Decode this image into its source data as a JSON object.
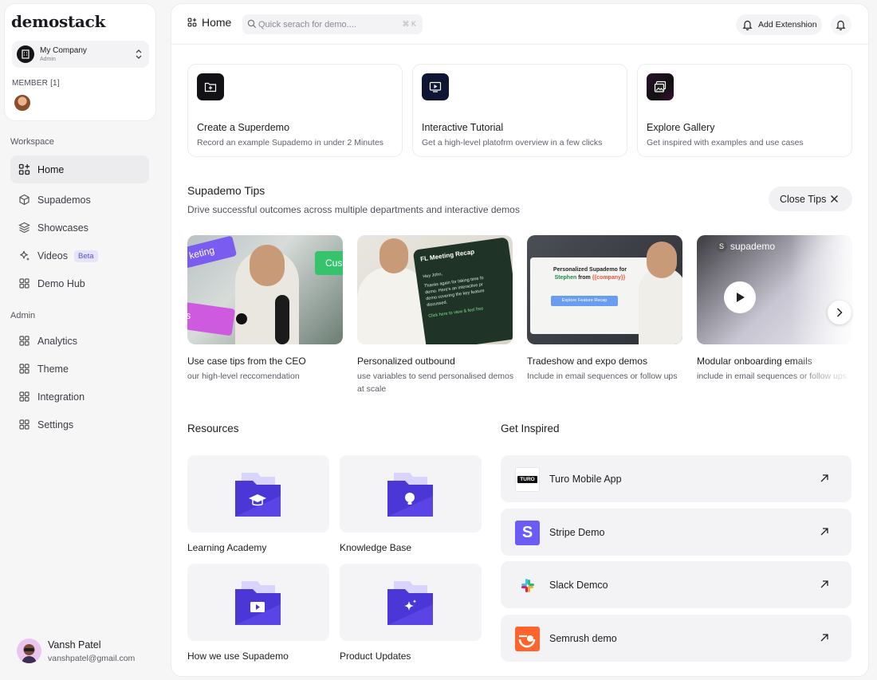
{
  "brand": "demostack",
  "workspace": {
    "company_name": "My Company",
    "company_role": "Admin",
    "member_label": "MEMBER [1]"
  },
  "sidebar": {
    "workspace_label": "Workspace",
    "workspace_items": [
      {
        "label": "Home",
        "icon": "home-grid-icon",
        "active": true
      },
      {
        "label": "Supademos",
        "icon": "cube-icon"
      },
      {
        "label": "Showcases",
        "icon": "layers-icon"
      },
      {
        "label": "Videos",
        "icon": "sparkle-icon",
        "badge": "Beta"
      },
      {
        "label": "Demo Hub",
        "icon": "grid-icon"
      }
    ],
    "admin_label": "Admin",
    "admin_items": [
      {
        "label": "Analytics",
        "icon": "grid-icon"
      },
      {
        "label": "Theme",
        "icon": "grid-icon"
      },
      {
        "label": "Integration",
        "icon": "grid-icon"
      },
      {
        "label": "Settings",
        "icon": "grid-icon"
      }
    ]
  },
  "user": {
    "name": "Vansh Patel",
    "email": "vanshpatel@gmail.com"
  },
  "topbar": {
    "title": "Home",
    "search_placeholder": "Quick serach for demo....",
    "search_shortcut": "⌘ K",
    "add_extension": "Add Extenshion"
  },
  "quick_actions": [
    {
      "title": "Create a Superdemo",
      "subtitle": "Record an example Supademo in under 2 Minutes",
      "icon": "folder-plus-icon"
    },
    {
      "title": "Interactive Tutorial",
      "subtitle": "Get a high-level platofrm overview in a few clicks",
      "icon": "play-screen-icon"
    },
    {
      "title": "Explore Gallery",
      "subtitle": "Get inspired with examples and use cases",
      "icon": "gallery-icon"
    }
  ],
  "tips": {
    "title": "Supademo Tips",
    "subtitle": "Drive successful outcomes across multiple departments and interactive demos",
    "close_label": "Close Tips",
    "items": [
      {
        "title": "Use case tips from the CEO",
        "desc": "our high-level reccomendation",
        "thumb_tags": [
          "keting",
          "Cus",
          "s"
        ]
      },
      {
        "title": "Personalized outbound",
        "desc": "use variables to send personalised demos at scale",
        "thumb_card_title": "FL Meeting Recap",
        "thumb_card_lines": [
          "Hey John,",
          "Thanks again for taking time fo",
          "demo. Here's an interactive pr",
          "demo covering the key feature",
          "discussed.",
          "Click here to view & feel free"
        ]
      },
      {
        "title": "Tradeshow and expo demos",
        "desc": "Include in email sequences or follow ups",
        "thumb_line1": "Personalized Supademo for",
        "thumb_name": "Stephen",
        "thumb_from": "from",
        "thumb_var": "{{company}}",
        "thumb_button": "Explore Feature Recap"
      },
      {
        "title": "Modular onboarding emails",
        "desc": "include in email sequences or follow ups",
        "thumb_logo": "supademo"
      }
    ]
  },
  "resources": {
    "title": "Resources",
    "items": [
      {
        "label": "Learning Academy",
        "icon": "graduation-cap-folder-icon"
      },
      {
        "label": "Knowledge Base",
        "icon": "lightbulb-folder-icon"
      },
      {
        "label": "How we use Supademo",
        "icon": "video-folder-icon"
      },
      {
        "label": "Product Updates",
        "icon": "sparkle-folder-icon"
      }
    ]
  },
  "inspired": {
    "title": "Get Inspired",
    "items": [
      {
        "label": "Turo Mobile App",
        "logo_text": "TURO",
        "logo": "turo-logo"
      },
      {
        "label": "Stripe Demo",
        "logo_text": "S",
        "logo": "stripe-logo"
      },
      {
        "label": "Slack Demco",
        "logo": "slack-logo"
      },
      {
        "label": "Semrush demo",
        "logo": "semrush-logo"
      }
    ]
  },
  "colors": {
    "accent": "#5b45e0",
    "folder": "#4b36d6",
    "folder_back": "#d9d4fb",
    "stripe": "#6a5cf5",
    "semrush": "#ff642d"
  }
}
